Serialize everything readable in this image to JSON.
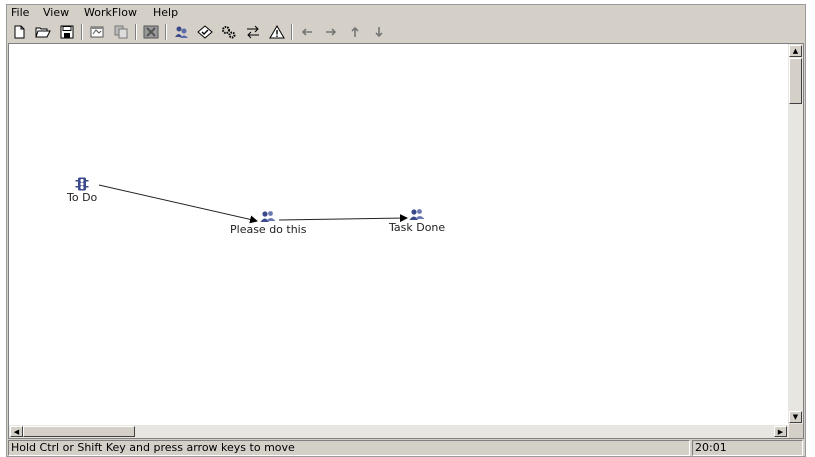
{
  "menu": {
    "items": [
      "File",
      "View",
      "WorkFlow",
      "Help"
    ]
  },
  "toolbar": {
    "buttons": [
      "new-document-icon",
      "open-folder-icon",
      "save-icon",
      "properties-icon",
      "copy-icon",
      "delete-icon",
      "add-task-icon",
      "validate-icon",
      "settings-icon",
      "transition-icon",
      "warning-icon",
      "arrow-left-icon",
      "arrow-right-icon",
      "arrow-up-icon",
      "arrow-down-icon"
    ]
  },
  "workflow": {
    "nodes": [
      {
        "id": "todo",
        "label": "To Do",
        "icon": "traffic-light-icon"
      },
      {
        "id": "please",
        "label": "Please do this",
        "icon": "task-people-icon"
      },
      {
        "id": "done",
        "label": "Task Done",
        "icon": "task-people-icon"
      }
    ],
    "edges": [
      {
        "from": "todo",
        "to": "please"
      },
      {
        "from": "please",
        "to": "done"
      }
    ]
  },
  "status": {
    "message": "Hold Ctrl or Shift Key and press arrow keys to move",
    "time": "20:01"
  },
  "colors": {
    "panel": "#d4d0c8",
    "canvas": "#ffffff",
    "icon_blue": "#3a4a8a"
  }
}
